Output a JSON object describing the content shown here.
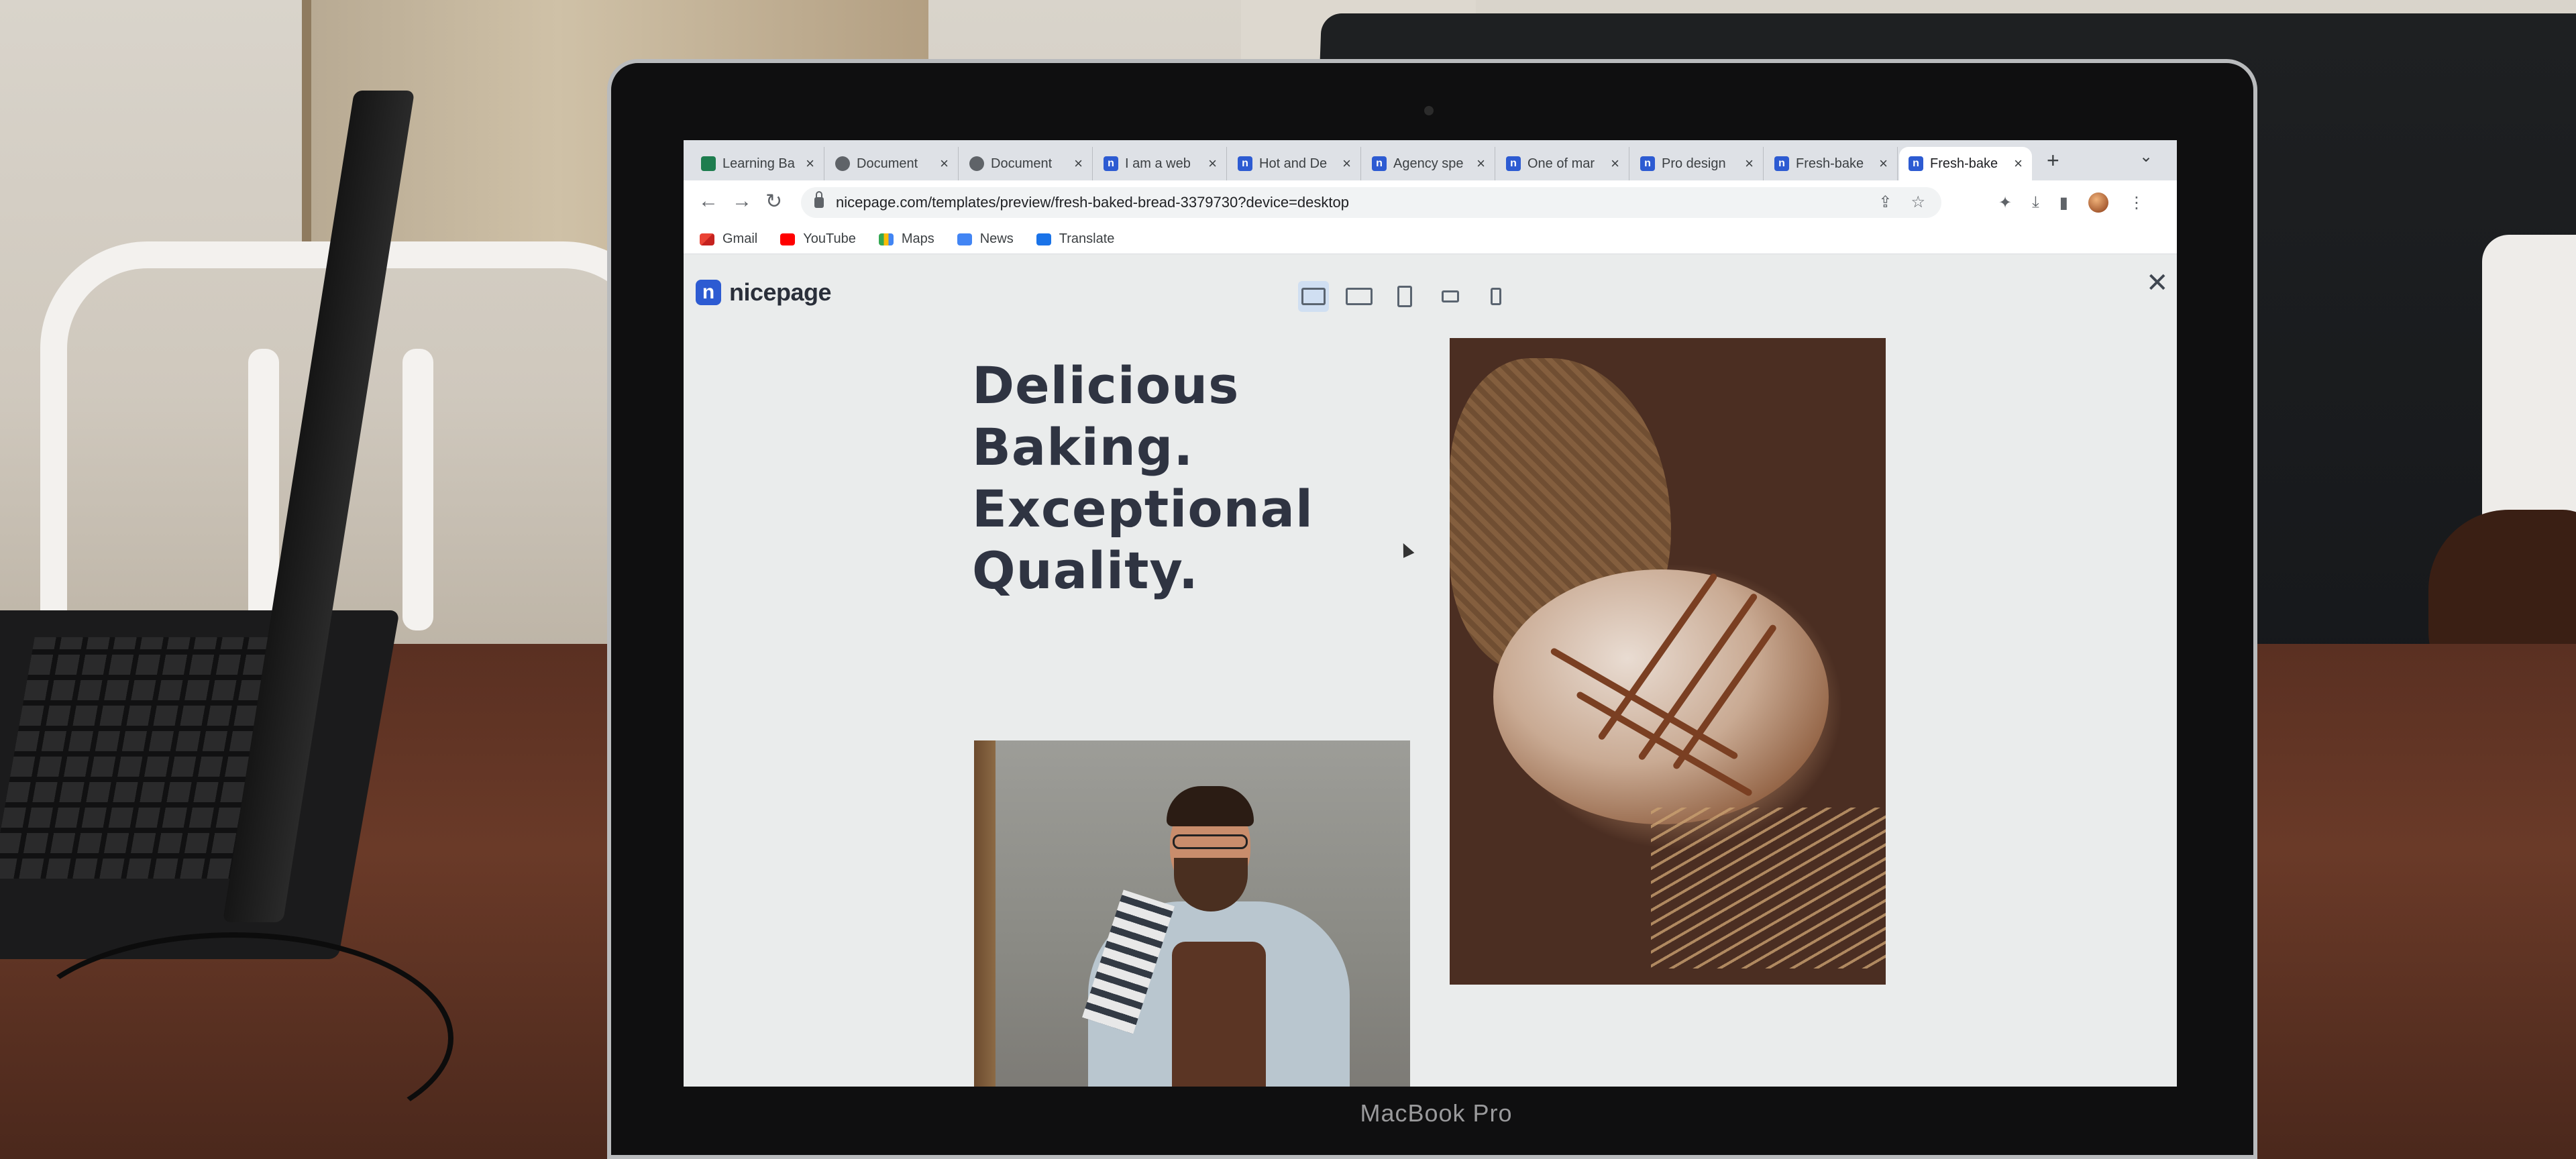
{
  "browser": {
    "tabs": [
      {
        "title": "Learning Ba",
        "favicon": "learning-favicon"
      },
      {
        "title": "Document",
        "favicon": "globe-favicon"
      },
      {
        "title": "Document",
        "favicon": "globe-favicon"
      },
      {
        "title": "I am a web",
        "favicon": "nicepage-favicon"
      },
      {
        "title": "Hot and De",
        "favicon": "nicepage-favicon"
      },
      {
        "title": "Agency spe",
        "favicon": "nicepage-favicon"
      },
      {
        "title": "One of mar",
        "favicon": "nicepage-favicon"
      },
      {
        "title": "Pro design",
        "favicon": "nicepage-favicon"
      },
      {
        "title": "Fresh-bake",
        "favicon": "nicepage-favicon"
      },
      {
        "title": "Fresh-bake",
        "favicon": "nicepage-favicon",
        "active": true
      }
    ],
    "new_tab": "+",
    "tab_menu": "⌄",
    "url": "nicepage.com/templates/preview/fresh-baked-bread-3379730?device=desktop",
    "bookmarks": [
      {
        "label": "Gmail",
        "icon": "gmail-icon"
      },
      {
        "label": "YouTube",
        "icon": "youtube-icon"
      },
      {
        "label": "Maps",
        "icon": "maps-icon"
      },
      {
        "label": "News",
        "icon": "news-icon"
      },
      {
        "label": "Translate",
        "icon": "translate-icon"
      }
    ]
  },
  "page": {
    "logo_text": "nicepage",
    "logo_mark": "n",
    "close": "✕",
    "headline": [
      "Delicious",
      "Baking.",
      "Exceptional",
      "Quality."
    ],
    "device_preview": [
      "desktop",
      "laptop",
      "tablet",
      "phone-landscape",
      "phone"
    ],
    "selected_device": "desktop"
  },
  "device_label": "MacBook Pro",
  "colors": {
    "nicepage_blue": "#2d5bd2",
    "headline": "#2f3442",
    "page_bg": "#eaecec"
  }
}
